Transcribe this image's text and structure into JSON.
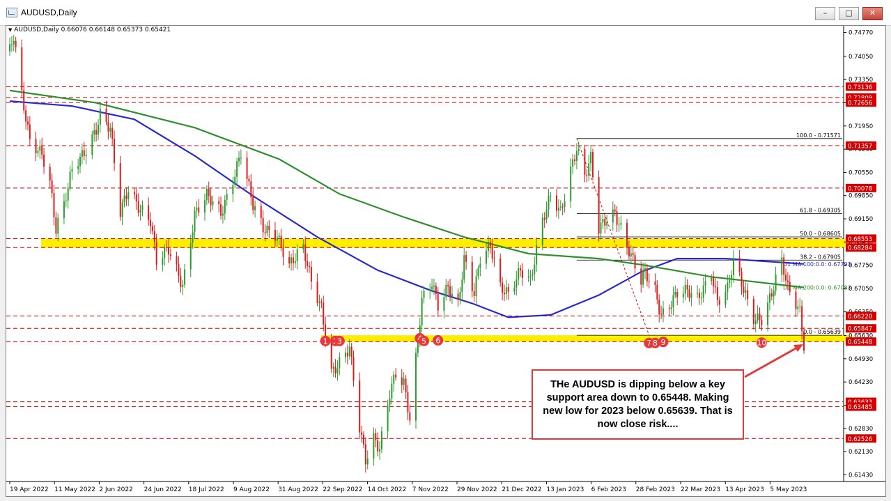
{
  "window": {
    "title": "AUDUSD,Daily",
    "buttons": {
      "minimize": "–",
      "maximize": "□",
      "close": "✕"
    }
  },
  "colors": {
    "bull_candle": "#2a9d2a",
    "bear_candle": "#e01b1b",
    "ma100": "#2a2acc",
    "ma200": "#2f8f2f",
    "zone": "#ffee00",
    "level_line": "#d40000",
    "marker": "#e8393a",
    "callout_border": "#e23a3a"
  },
  "chart_data": {
    "type": "candlestick",
    "symbol": "AUDUSD",
    "timeframe": "Daily",
    "ohlc_label": "AUDUSD,Daily  0.66076 0.66148 0.65373 0.65421",
    "ylim": [
      0.6125,
      0.7495
    ],
    "y_ticks": [
      "0.74770",
      "0.74050",
      "0.73350",
      "0.72650",
      "0.71950",
      "0.71250",
      "0.70550",
      "0.69850",
      "0.69150",
      "0.68450",
      "0.67750",
      "0.67050",
      "0.66350",
      "0.65630",
      "0.64930",
      "0.64230",
      "0.63530",
      "0.62830",
      "0.62130",
      "0.61430"
    ],
    "x_ticks": [
      "19 Apr 2022",
      "11 May 2022",
      "2 Jun 2022",
      "24 Jun 2022",
      "18 Jul 2022",
      "9 Aug 2022",
      "31 Aug 2022",
      "22 Sep 2022",
      "14 Oct 2022",
      "7 Nov 2022",
      "29 Nov 2022",
      "21 Dec 2022",
      "13 Jan 2023",
      "6 Feb 2023",
      "28 Feb 2023",
      "22 Mar 2023",
      "13 Apr 2023",
      "5 May 2023"
    ],
    "x_range": [
      "2022-04-19",
      "2023-05-19"
    ],
    "close_path": [
      [
        "2022-04-19",
        0.742
      ],
      [
        "2022-04-21",
        0.746
      ],
      [
        "2022-04-25",
        0.728
      ],
      [
        "2022-04-29",
        0.715
      ],
      [
        "2022-05-05",
        0.712
      ],
      [
        "2022-05-09",
        0.703
      ],
      [
        "2022-05-12",
        0.688
      ],
      [
        "2022-05-16",
        0.695
      ],
      [
        "2022-05-20",
        0.706
      ],
      [
        "2022-05-26",
        0.712
      ],
      [
        "2022-06-01",
        0.719
      ],
      [
        "2022-06-03",
        0.723
      ],
      [
        "2022-06-08",
        0.718
      ],
      [
        "2022-06-13",
        0.693
      ],
      [
        "2022-06-17",
        0.701
      ],
      [
        "2022-06-22",
        0.696
      ],
      [
        "2022-06-28",
        0.691
      ],
      [
        "2022-07-01",
        0.678
      ],
      [
        "2022-07-07",
        0.682
      ],
      [
        "2022-07-14",
        0.672
      ],
      [
        "2022-07-20",
        0.693
      ],
      [
        "2022-07-26",
        0.698
      ],
      [
        "2022-08-02",
        0.693
      ],
      [
        "2022-08-07",
        0.702
      ],
      [
        "2022-08-12",
        0.712
      ],
      [
        "2022-08-18",
        0.695
      ],
      [
        "2022-08-23",
        0.688
      ],
      [
        "2022-08-30",
        0.687
      ],
      [
        "2022-09-05",
        0.678
      ],
      [
        "2022-09-12",
        0.682
      ],
      [
        "2022-09-16",
        0.672
      ],
      [
        "2022-09-21",
        0.665
      ],
      [
        "2022-09-26",
        0.646
      ],
      [
        "2022-09-30",
        0.648
      ],
      [
        "2022-10-05",
        0.652
      ],
      [
        "2022-10-10",
        0.628
      ],
      [
        "2022-10-13",
        0.619
      ],
      [
        "2022-10-17",
        0.626
      ],
      [
        "2022-10-20",
        0.623
      ],
      [
        "2022-10-25",
        0.639
      ],
      [
        "2022-10-28",
        0.644
      ],
      [
        "2022-11-01",
        0.641
      ],
      [
        "2022-11-04",
        0.631
      ],
      [
        "2022-11-10",
        0.668
      ],
      [
        "2022-11-15",
        0.673
      ],
      [
        "2022-11-18",
        0.665
      ],
      [
        "2022-11-23",
        0.67
      ],
      [
        "2022-11-28",
        0.665
      ],
      [
        "2022-12-01",
        0.68
      ],
      [
        "2022-12-06",
        0.67
      ],
      [
        "2022-12-09",
        0.68
      ],
      [
        "2022-12-14",
        0.683
      ],
      [
        "2022-12-19",
        0.67
      ],
      [
        "2022-12-23",
        0.669
      ],
      [
        "2022-12-29",
        0.677
      ],
      [
        "2023-01-03",
        0.673
      ],
      [
        "2023-01-09",
        0.69
      ],
      [
        "2023-01-13",
        0.698
      ],
      [
        "2023-01-18",
        0.694
      ],
      [
        "2023-01-23",
        0.707
      ],
      [
        "2023-01-26",
        0.713
      ],
      [
        "2023-01-30",
        0.704
      ],
      [
        "2023-02-02",
        0.709
      ],
      [
        "2023-02-06",
        0.688
      ],
      [
        "2023-02-10",
        0.692
      ],
      [
        "2023-02-14",
        0.694
      ],
      [
        "2023-02-17",
        0.689
      ],
      [
        "2023-02-22",
        0.68
      ],
      [
        "2023-02-27",
        0.672
      ],
      [
        "2023-03-01",
        0.675
      ],
      [
        "2023-03-06",
        0.67
      ],
      [
        "2023-03-09",
        0.663
      ],
      [
        "2023-03-13",
        0.666
      ],
      [
        "2023-03-17",
        0.669
      ],
      [
        "2023-03-22",
        0.669
      ],
      [
        "2023-03-27",
        0.667
      ],
      [
        "2023-04-03",
        0.676
      ],
      [
        "2023-04-06",
        0.667
      ],
      [
        "2023-04-11",
        0.67
      ],
      [
        "2023-04-14",
        0.678
      ],
      [
        "2023-04-19",
        0.67
      ],
      [
        "2023-04-24",
        0.662
      ],
      [
        "2023-04-28",
        0.662
      ],
      [
        "2023-05-03",
        0.669
      ],
      [
        "2023-05-08",
        0.678
      ],
      [
        "2023-05-11",
        0.67
      ],
      [
        "2023-05-15",
        0.666
      ],
      [
        "2023-05-17",
        0.664
      ],
      [
        "2023-05-19",
        0.6542
      ]
    ],
    "ma_series": [
      {
        "name": "D1 MA:100:0.0: 0.67793",
        "color": "#2a2acc",
        "points": [
          [
            "2022-04-19",
            0.727
          ],
          [
            "2022-05-20",
            0.7255
          ],
          [
            "2022-06-20",
            0.7215
          ],
          [
            "2022-07-20",
            0.7105
          ],
          [
            "2022-08-19",
            0.698
          ],
          [
            "2022-09-19",
            0.686
          ],
          [
            "2022-10-19",
            0.676
          ],
          [
            "2022-11-14",
            0.67
          ],
          [
            "2022-12-05",
            0.666
          ],
          [
            "2022-12-23",
            0.6618
          ],
          [
            "2023-01-13",
            0.6625
          ],
          [
            "2023-02-06",
            0.6685
          ],
          [
            "2023-02-27",
            0.6755
          ],
          [
            "2023-03-17",
            0.6795
          ],
          [
            "2023-04-10",
            0.6795
          ],
          [
            "2023-05-19",
            0.6779
          ]
        ]
      },
      {
        "name": "D1 MA:200:0.0: 0.67083",
        "color": "#2f8f2f",
        "points": [
          [
            "2022-04-19",
            0.7302
          ],
          [
            "2022-06-01",
            0.7265
          ],
          [
            "2022-07-20",
            0.719
          ],
          [
            "2022-08-31",
            0.7095
          ],
          [
            "2022-09-30",
            0.699
          ],
          [
            "2022-11-01",
            0.692
          ],
          [
            "2022-12-01",
            0.686
          ],
          [
            "2023-01-02",
            0.681
          ],
          [
            "2023-02-06",
            0.6795
          ],
          [
            "2023-03-01",
            0.6775
          ],
          [
            "2023-04-03",
            0.674
          ],
          [
            "2023-05-19",
            0.6708
          ]
        ]
      }
    ],
    "zones": [
      {
        "from": 0.6828,
        "to": 0.6855
      },
      {
        "from": 0.6545,
        "to": 0.6564
      }
    ],
    "horizontal_levels": [
      {
        "value": 0.73136,
        "label": "0.73136"
      },
      {
        "value": 0.72809,
        "label": "0.72809"
      },
      {
        "value": 0.72656,
        "label": "0.72656"
      },
      {
        "value": 0.71357,
        "label": "0.71357"
      },
      {
        "value": 0.70078,
        "label": "0.70078"
      },
      {
        "value": 0.68553,
        "label": "0.68553"
      },
      {
        "value": 0.68284,
        "label": "0.68284"
      },
      {
        "value": 0.6622,
        "label": "0.66220"
      },
      {
        "value": 0.65847,
        "label": "0.65847"
      },
      {
        "value": 0.65448,
        "label": "0.65448"
      },
      {
        "value": 0.63633,
        "label": "0.63633"
      },
      {
        "value": 0.63485,
        "label": "0.63485"
      },
      {
        "value": 0.62526,
        "label": "0.62526"
      }
    ],
    "fibonacci": {
      "start": "2023-01-26",
      "levels": [
        {
          "value": 0.71571,
          "label": "100.0 - 0.71571"
        },
        {
          "value": 0.69305,
          "label": "61.8 - 0.69305"
        },
        {
          "value": 0.68605,
          "label": "50.0 - 0.68605"
        },
        {
          "value": 0.67905,
          "label": "38.2 - 0.67905"
        },
        {
          "value": 0.65639,
          "label": "0.0 - 0.65639"
        }
      ]
    },
    "markers": [
      {
        "label": "1",
        "date": "2022-09-23",
        "value": 0.6555
      },
      {
        "label": "2",
        "date": "2022-09-28",
        "value": 0.6555
      },
      {
        "label": "3",
        "date": "2022-09-30",
        "value": 0.6555
      },
      {
        "label": "4",
        "date": "2022-11-09",
        "value": 0.6563
      },
      {
        "label": "5",
        "date": "2022-11-11",
        "value": 0.6555
      },
      {
        "label": "6",
        "date": "2022-11-18",
        "value": 0.6557
      },
      {
        "label": "7",
        "date": "2023-03-03",
        "value": 0.6549
      },
      {
        "label": "8",
        "date": "2023-03-06",
        "value": 0.6549
      },
      {
        "label": "9",
        "date": "2023-03-10",
        "value": 0.6552
      },
      {
        "label": "10",
        "date": "2023-04-28",
        "value": 0.655
      }
    ],
    "current_price": 0.65421,
    "annotation": "THe AUDUSD is dipping below a key support area down to 0.65448.  Making new low for 2023 below 0.65639.  That is now close risk...."
  }
}
